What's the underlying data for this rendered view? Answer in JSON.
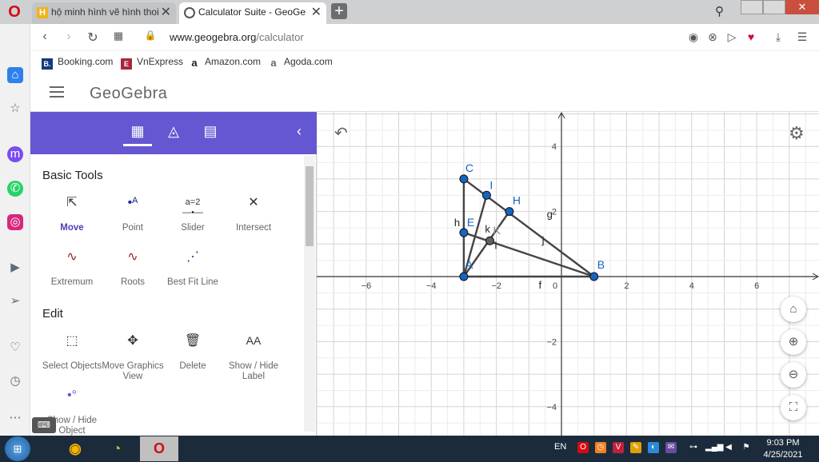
{
  "browser": {
    "tabs": [
      {
        "title": "hộ minh hình vẽ hình thoi",
        "icon": "hoc247-icon"
      },
      {
        "title": "Calculator Suite - GeoGebra",
        "icon": "geogebra-icon"
      }
    ],
    "url_domain": "www.geogebra.org",
    "url_path": "/calculator",
    "bookmarks": [
      {
        "label": "Booking.com",
        "icon": "B."
      },
      {
        "label": "VnExpress",
        "icon": "E"
      },
      {
        "label": "Amazon.com",
        "icon": "a"
      },
      {
        "label": "Agoda.com",
        "icon": "a"
      }
    ]
  },
  "app": {
    "logo": "GeoGebra"
  },
  "toolbar": {
    "section_basic": "Basic Tools",
    "basic_tools": [
      "Move",
      "Point",
      "Slider",
      "Intersect",
      "Extremum",
      "Roots",
      "Best Fit Line"
    ],
    "section_edit": "Edit",
    "edit_tools": [
      "Select Objects",
      "Move Graphics View",
      "Delete",
      "Show / Hide Label",
      "Show / Hide Object"
    ],
    "active_tool": "Move"
  },
  "graph": {
    "x_ticks": [
      "−6",
      "−4",
      "−2",
      "0",
      "2",
      "4",
      "6"
    ],
    "y_ticks": [
      "4",
      "2",
      "−2",
      "−4"
    ],
    "points": [
      {
        "name": "C",
        "x": -3,
        "y": 3
      },
      {
        "name": "I",
        "x": -2.3,
        "y": 2.5
      },
      {
        "name": "H",
        "x": -1.6,
        "y": 2
      },
      {
        "name": "E",
        "x": -3,
        "y": 1.35
      },
      {
        "name": "K",
        "x": -2.2,
        "y": 1.1
      },
      {
        "name": "A",
        "x": -3,
        "y": 0
      },
      {
        "name": "B",
        "x": 1,
        "y": 0
      }
    ],
    "line_labels": [
      "f",
      "g",
      "h",
      "i",
      "j",
      "k"
    ]
  },
  "taskbar": {
    "lang": "EN",
    "time": "9:03 PM",
    "date": "4/25/2021"
  },
  "colors": {
    "accent": "#6557d2",
    "point": "#1565c0",
    "point_k": "#616161"
  }
}
